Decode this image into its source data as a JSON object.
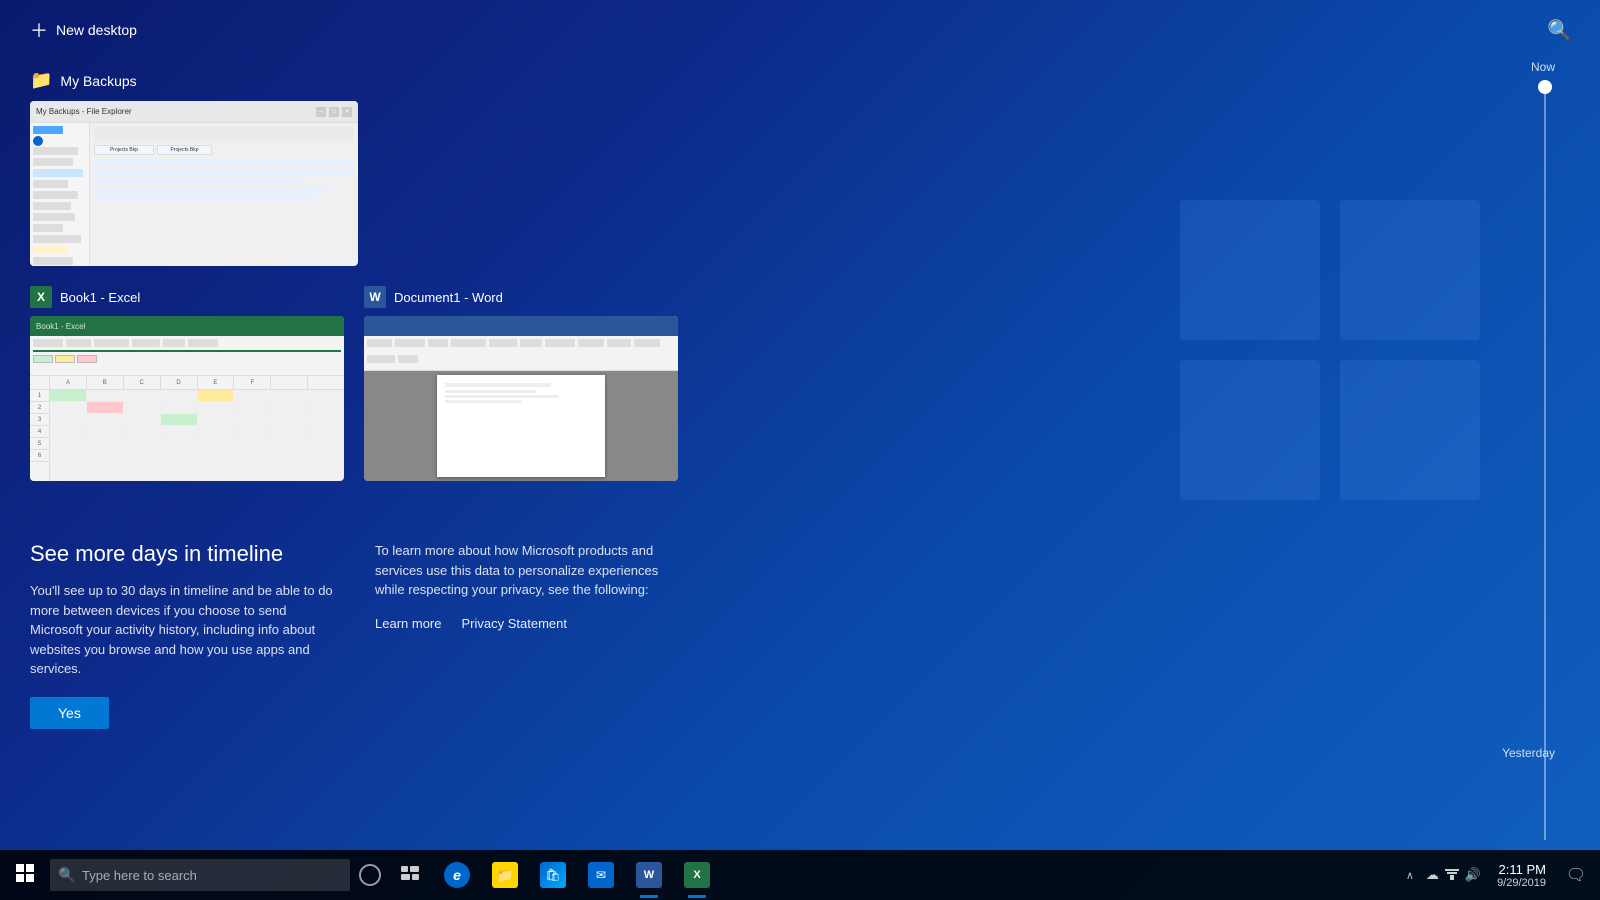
{
  "topbar": {
    "new_desktop_label": "New desktop",
    "search_icon_label": "🔍"
  },
  "timeline": {
    "now_label": "Now",
    "yesterday_label": "Yesterday"
  },
  "sections": {
    "my_backups": {
      "label": "My Backups",
      "folder_icon": "📁",
      "window_title": "My Backups"
    },
    "excel": {
      "app_name": "Book1 - Excel",
      "icon_letter": "X"
    },
    "word": {
      "app_name": "Document1 - Word",
      "icon_letter": "W"
    }
  },
  "promo": {
    "heading": "See more days in timeline",
    "col1_text": "You'll see up to 30 days in timeline and be able to do more between devices if you choose to send Microsoft your activity history, including info about websites you browse and how you use apps and services.",
    "col2_text": "To learn more about how Microsoft products and services use this data to personalize experiences while respecting your privacy, see the following:",
    "learn_more": "Learn more",
    "privacy_statement": "Privacy Statement",
    "yes_button": "Yes"
  },
  "taskbar": {
    "search_placeholder": "Type here to search",
    "apps": [
      {
        "name": "Internet Explorer",
        "type": "ie"
      },
      {
        "name": "File Explorer",
        "type": "explorer"
      },
      {
        "name": "Microsoft Store",
        "type": "store"
      },
      {
        "name": "Mail",
        "type": "mail"
      },
      {
        "name": "Word",
        "type": "word",
        "active": true
      },
      {
        "name": "Excel",
        "type": "excel",
        "active": true
      }
    ],
    "clock": {
      "time": "2:11 PM",
      "date": "9/29/2019"
    }
  }
}
